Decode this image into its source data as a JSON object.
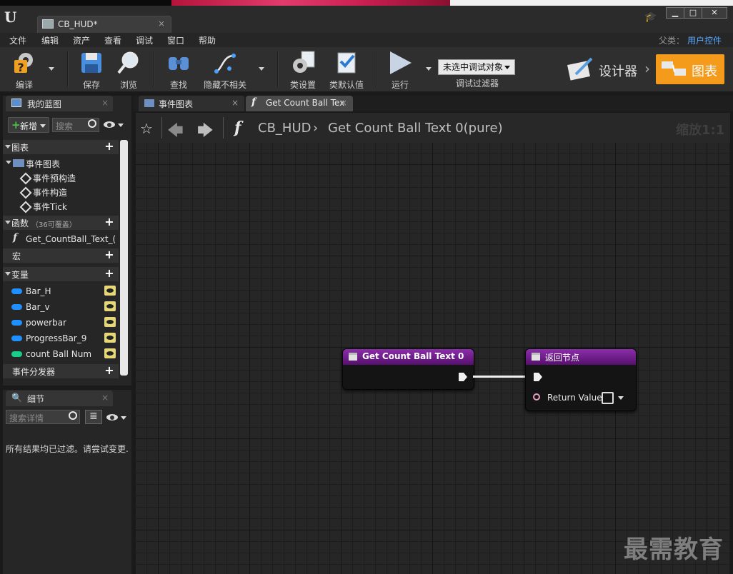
{
  "titlebar": {
    "doc_tab": "CB_HUD*",
    "close": "×"
  },
  "window_controls": {
    "minimize": "▁",
    "maximize": "□",
    "close": "✕"
  },
  "menubar": {
    "items": [
      "文件",
      "编辑",
      "资产",
      "查看",
      "调试",
      "窗口",
      "帮助"
    ]
  },
  "parent": {
    "label": "父类：",
    "value": "用户控件"
  },
  "toolbar": {
    "compile": "编译",
    "save": "保存",
    "browse": "浏览",
    "find": "查找",
    "hide_unrelated": "隐藏不相关",
    "class_settings": "类设置",
    "class_defaults": "类默认值",
    "run": "运行",
    "debug_filter_value": "未选中调试对象",
    "debug_filter_label": "调试过滤器"
  },
  "modes": {
    "designer": "设计器",
    "graph": "图表"
  },
  "my_blueprint": {
    "tab": "我的蓝图",
    "add_button": "新增",
    "search_placeholder": "搜索",
    "graphs": {
      "label": "图表",
      "event_graph": "事件图表",
      "items": [
        "事件预构造",
        "事件构造",
        "事件Tick"
      ]
    },
    "functions": {
      "label": "函数",
      "overridable": "（36可覆盖）",
      "items": [
        "Get_CountBall_Text_("
      ]
    },
    "macros": {
      "label": "宏"
    },
    "variables": {
      "label": "变量",
      "items": [
        {
          "name": "Bar_H",
          "color": "#1e90ff"
        },
        {
          "name": "Bar_v",
          "color": "#1e90ff"
        },
        {
          "name": "powerbar",
          "color": "#1e90ff"
        },
        {
          "name": "ProgressBar_9",
          "color": "#1e90ff"
        },
        {
          "name": "count Ball Num",
          "color": "#16d08a"
        }
      ]
    },
    "dispatchers": {
      "label": "事件分发器"
    }
  },
  "details": {
    "tab": "细节",
    "search_placeholder": "搜索详情",
    "message": "所有结果均已过滤。请尝试变更."
  },
  "graph_tabs": [
    {
      "label": "事件图表"
    },
    {
      "label": "Get Count Ball Tex"
    }
  ],
  "breadcrumb": {
    "root": "CB_HUD",
    "sep": "›",
    "leaf": "Get Count Ball Text 0(pure)"
  },
  "zoom": "缩放1:1",
  "nodes": {
    "entry": {
      "title": "Get Count Ball Text 0"
    },
    "return": {
      "title": "返回节点",
      "pin_label": "Return Value"
    }
  },
  "watermark": "最需教育"
}
